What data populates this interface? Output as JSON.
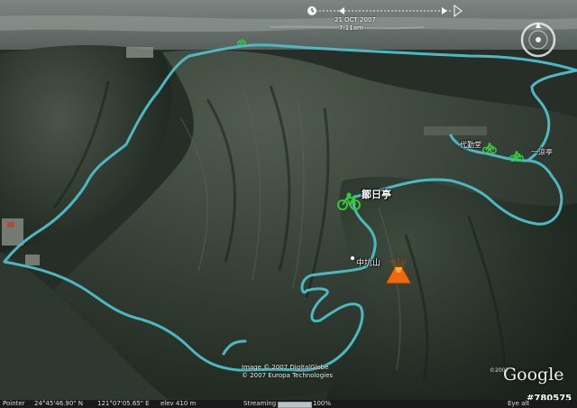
{
  "time": {
    "date": "21 OCT 2007",
    "clock": "7:11am"
  },
  "places": {
    "pavilion_main": "鄒日亭",
    "mountain": "中坑山",
    "activity_hall": "代勤堂",
    "first_pavilion": "一涼亭"
  },
  "attribution": {
    "line1": "Image © 2007 DigitalGlobe",
    "line2": "© 2007 Europa Technologies"
  },
  "logo": {
    "text": "Google",
    "year": "©2007"
  },
  "watermark": "#780575",
  "status": {
    "pointer_label": "Pointer",
    "latitude": "24°45'46.90\" N",
    "longitude": "121°07'05.65\" E",
    "elevation": "elev  410 m",
    "streaming_label": "Streaming",
    "streaming_pct": "100%",
    "streaming_progress": 1.0,
    "eye_label": "Eye alt"
  },
  "icons": {
    "bike": "bicycle-icon",
    "volcano": "volcano-icon",
    "compass": "compass-navigation-icon",
    "timeslider": "time-slider-icon"
  },
  "colors": {
    "route": "#4bb8c2",
    "bike_marker": "#38c83a",
    "terrain_dark": "#2b342c"
  }
}
